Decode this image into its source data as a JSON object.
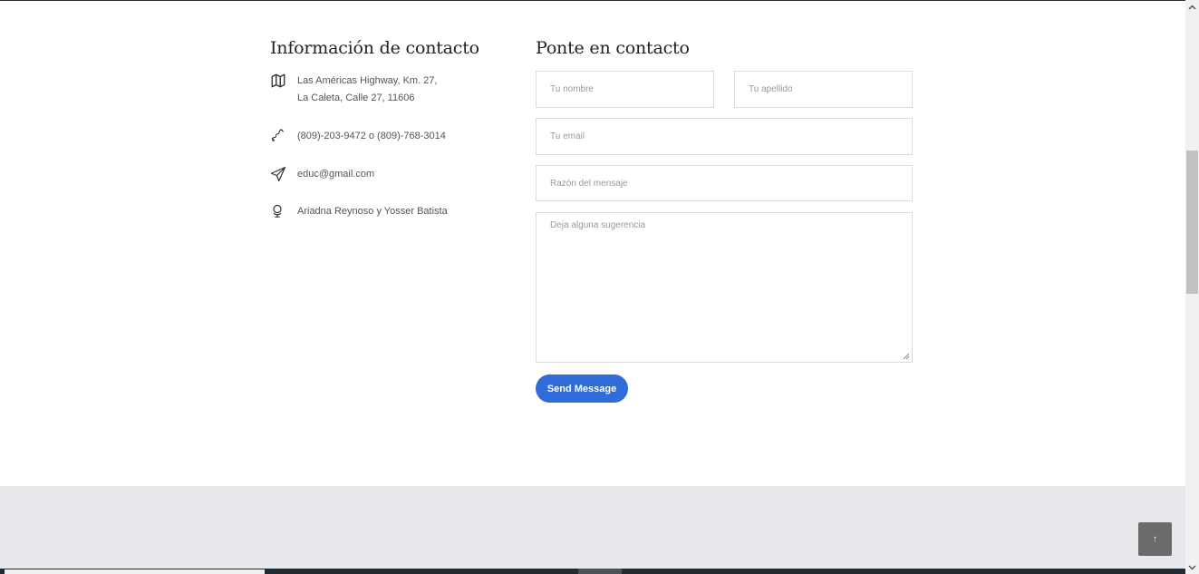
{
  "contact_info": {
    "heading": "Información de contacto",
    "address_line1": "Las Américas Highway, Km. 27,",
    "address_line2": "La Caleta, Calle 27, 11606",
    "phone": "(809)-203-9472 o (809)-768-3014",
    "email": "educ@gmail.com",
    "authors": "Ariadna Reynoso y Yosser Batista",
    "icons": [
      "map-icon",
      "phone-icon",
      "paper-plane-icon",
      "globe-icon"
    ]
  },
  "contact_form": {
    "heading": "Ponte en contacto",
    "first_name_placeholder": "Tu nombre",
    "last_name_placeholder": "Tu apellido",
    "email_placeholder": "Tu email",
    "subject_placeholder": "Razón del mensaje",
    "message_placeholder": "Deja alguna sugerencia",
    "send_label": "Send Message"
  },
  "back_to_top": {
    "glyph": "↑"
  },
  "colors": {
    "accent": "#2f6bd9",
    "footer_band": "#e8e9ed",
    "back_to_top_bg": "#6b6b6b"
  }
}
